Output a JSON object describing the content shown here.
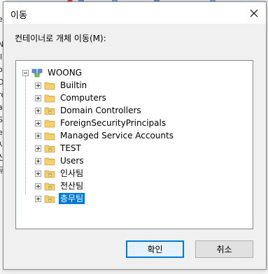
{
  "background": {
    "left_fragments": [
      "e",
      "l",
      "N",
      "il",
      "on",
      "Di",
      "re",
      "ar",
      "ST",
      "e",
      "사",
      "신",
      "무"
    ]
  },
  "dialog": {
    "title": "이동",
    "prompt": "컨테이너로 개체 이동(M):",
    "ok_label": "확인",
    "cancel_label": "취소"
  },
  "tree": {
    "root": {
      "label": "WOONG",
      "icon": "domain-icon",
      "expanded": true
    },
    "children": [
      {
        "label": "Builtin",
        "icon": "folder-icon"
      },
      {
        "label": "Computers",
        "icon": "folder-icon"
      },
      {
        "label": "Domain Controllers",
        "icon": "ou-folder-icon"
      },
      {
        "label": "ForeignSecurityPrincipals",
        "icon": "folder-icon"
      },
      {
        "label": "Managed Service Accounts",
        "icon": "folder-icon"
      },
      {
        "label": "TEST",
        "icon": "ou-folder-icon"
      },
      {
        "label": "Users",
        "icon": "folder-icon"
      },
      {
        "label": "인사팀",
        "icon": "ou-folder-icon"
      },
      {
        "label": "전산팀",
        "icon": "ou-folder-icon"
      },
      {
        "label": "총무팀",
        "icon": "ou-folder-icon",
        "selected": true
      }
    ]
  },
  "colors": {
    "selection": "#0078d7",
    "folder": "#f4d06f"
  }
}
